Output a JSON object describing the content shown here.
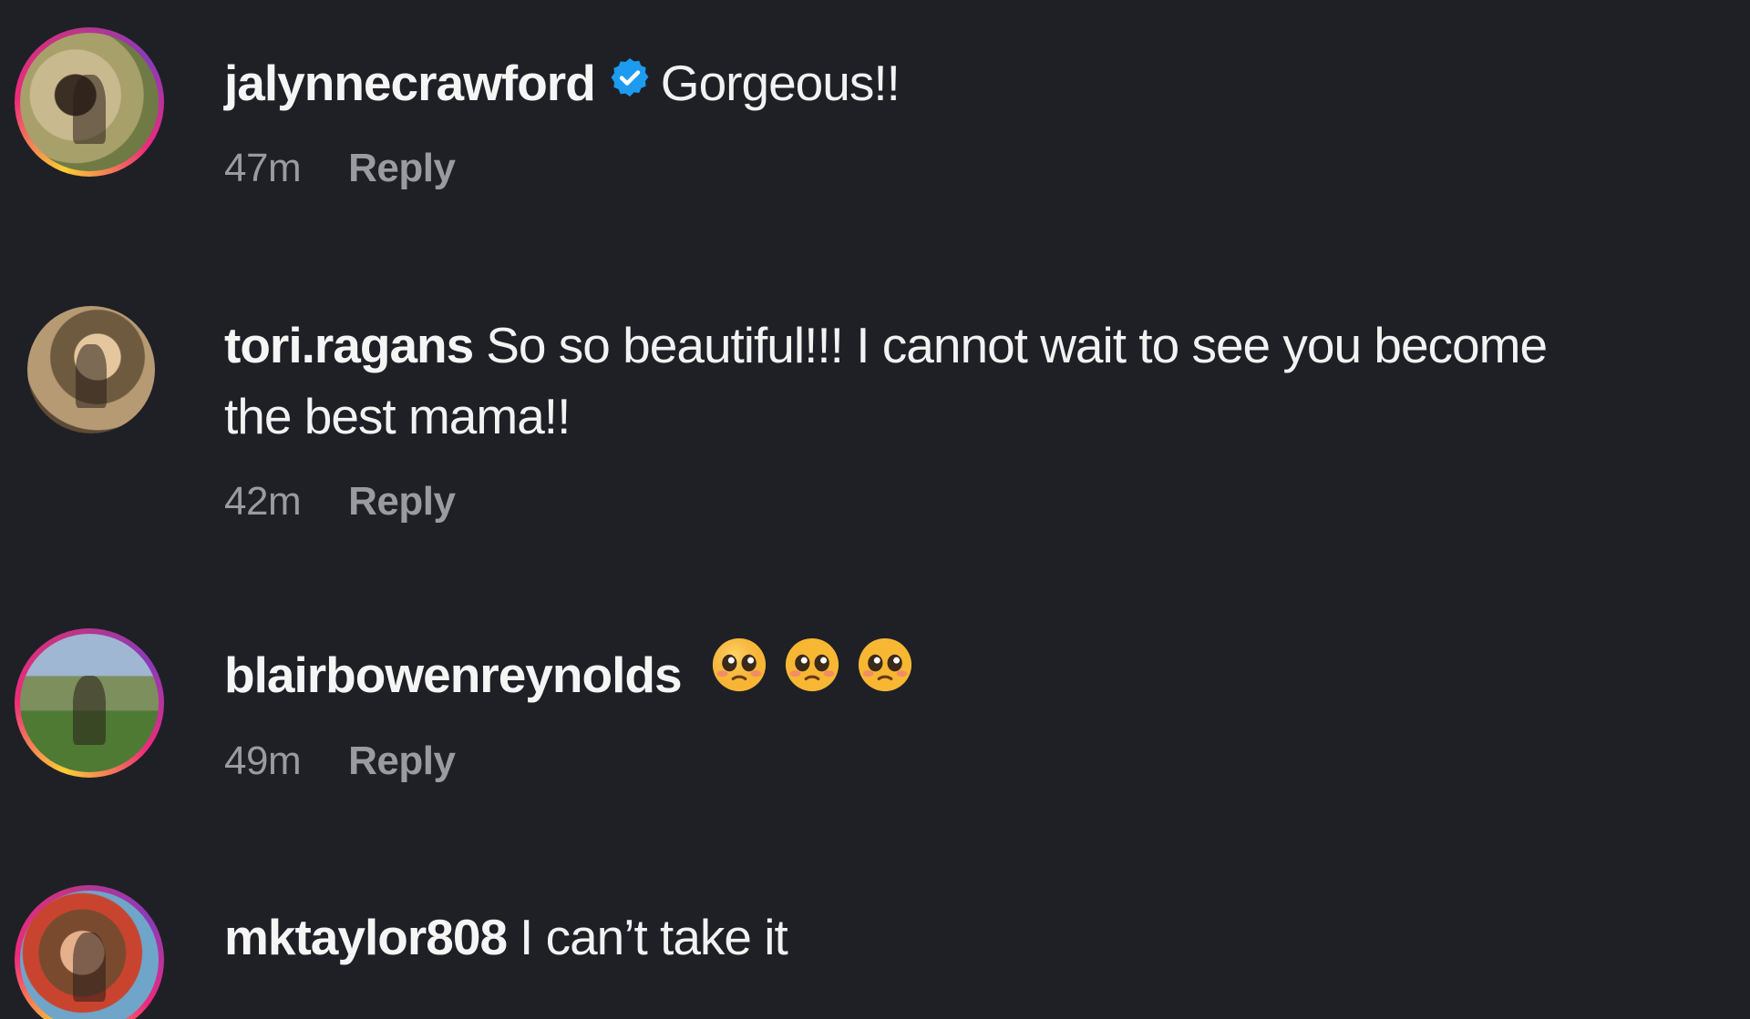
{
  "comments": [
    {
      "username": "jalynnecrawford",
      "verified": true,
      "text": "Gorgeous!!",
      "time": "47m",
      "reply_label": "Reply",
      "avatar_ring": true
    },
    {
      "username": "tori.ragans",
      "verified": false,
      "text": "So so beautiful!!! I cannot wait to see you become",
      "text_line2": "the best mama!!",
      "time": "42m",
      "reply_label": "Reply",
      "avatar_ring": false
    },
    {
      "username": "blairbowenreynolds",
      "verified": false,
      "text": "",
      "emojis": [
        "pleading-face-emoji",
        "pleading-face-emoji",
        "pleading-face-emoji"
      ],
      "time": "49m",
      "reply_label": "Reply",
      "avatar_ring": true
    },
    {
      "username": "mktaylor808",
      "verified": false,
      "text": "I can’t take it",
      "avatar_ring": true
    }
  ],
  "colors": {
    "background": "#1f2026",
    "text": "#f2f2f2",
    "meta": "#9a9ba1",
    "verified_badge": "#1d9bf0"
  }
}
